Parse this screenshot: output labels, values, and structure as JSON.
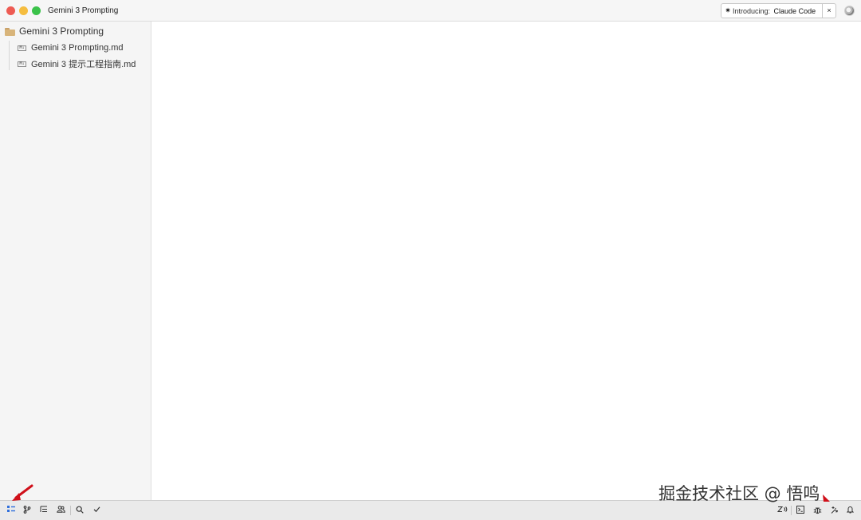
{
  "window": {
    "title": "Gemini 3 Prompting",
    "controls": [
      "close",
      "minimize",
      "maximize"
    ]
  },
  "banner": {
    "star": "✷",
    "prefix": "Introducing:",
    "product": "Claude Code",
    "close": "×"
  },
  "sidebar": {
    "root": {
      "label": "Gemini 3 Prompting",
      "icon": "folder-icon"
    },
    "files": [
      {
        "label": "Gemini 3 Prompting.md",
        "icon": "markdown-file-icon",
        "badge": "M↓"
      },
      {
        "label": "Gemini 3 提示工程指南.md",
        "icon": "markdown-file-icon",
        "badge": "M↓"
      }
    ]
  },
  "statusbar": {
    "left_icons": [
      "project-panel-icon",
      "git-branch-icon",
      "outline-icon",
      "collaborators-icon",
      "search-icon",
      "diagnostics-check-icon"
    ],
    "right_icons": [
      "zed-edit-prediction-icon",
      "terminal-icon",
      "debugger-icon",
      "assistant-sparkle-icon",
      "notification-bell-icon"
    ],
    "active_color": "#2f6fdc"
  },
  "watermark": "掘金技术社区 @ 悟鸣",
  "annotation_color": "#d0101a"
}
